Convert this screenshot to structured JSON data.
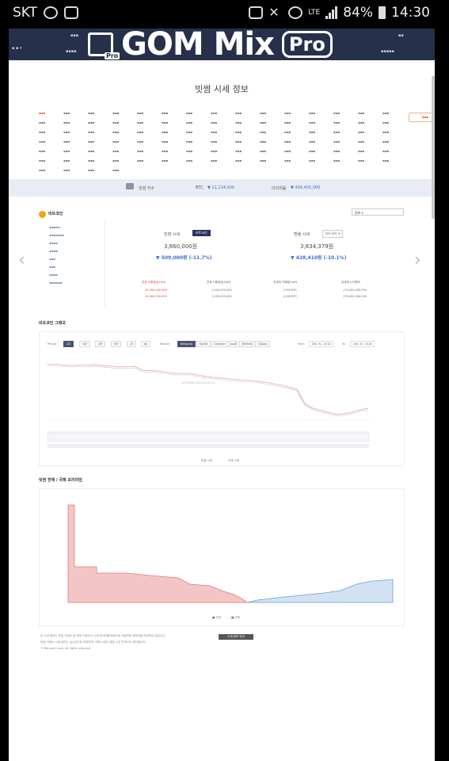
{
  "status_bar": {
    "carrier": "SKT",
    "lte": "LTE",
    "battery": "84%",
    "time": "14:30"
  },
  "watermark": {
    "text": "GOM Mix",
    "badge": "Pro",
    "small_badge": "Pro"
  },
  "page": {
    "title": "빗썸 시세 정보"
  },
  "ticker": {
    "label": "빗썸 지수",
    "btc_label": "BTC",
    "btc_value": "▼ 11,114,000",
    "eth_label": "이더리움",
    "eth_value": "▼ 439,405,000"
  },
  "section": {
    "coin_title": "비트코인",
    "chart_title": "비트코인 그래프",
    "premium_title": "빗썸 전체 / 국제 프리미엄",
    "select_value": "원화"
  },
  "price": {
    "bithumb_label": "빗썸 시세",
    "bithumb_tag": "비트코인",
    "bithumb_price": "3,860,000원",
    "bithumb_change": "▼ 509,000원 (-11.7%)",
    "global_label": "환율 시세",
    "global_select": "비트코인",
    "global_price": "3,834,379원",
    "global_change": "▼ 428,410원 (-10.1%)"
  },
  "stats": {
    "headers": [
      "빗썸 거래대금(24H)",
      "전체 거래대금(24H)",
      "전세계 거래량(24H)",
      "전세계 시가총액"
    ],
    "row1": [
      "10,000,000,000",
      "1,000,000,000",
      "1,000 BTC",
      "170,000,000,000"
    ],
    "row2": [
      "10,000,000,000",
      "1,000,000,000",
      "1,000 BTC",
      "170,000,000,000"
    ]
  },
  "chart1": {
    "period_label": "Period",
    "period_active": "1D",
    "periods": [
      "1W",
      "1M",
      "3M",
      "1Y",
      "All"
    ],
    "market_label": "Market",
    "market_active": "Bithumb",
    "markets": [
      "Korbit",
      "Coinone",
      "Upbit",
      "Bitfinex",
      "Gopax"
    ],
    "from_label": "From",
    "from_value": "Dec 31, 2018",
    "to_label": "To",
    "to_value": "Dec 31, 2018",
    "watermark": "BTC/KRW Bithumb price",
    "legend1": "빗썸 시세",
    "legend2": "국제 시세"
  },
  "chart2": {
    "legend_red": "빗썸",
    "legend_blue": "국제"
  },
  "footer": {
    "line1": "본 시세 정보는 빗썸 거래소 및 국제 거래소의 시세 데이터를 바탕으로 제공되며 정확성을 보장하지 않습니다.",
    "line2": "빗썸 거래소 시세 정보는 실시간으로 반영되며, 국제 시세는 일정 시간 간격으로 갱신됩니다.",
    "line3": "© Bithumb Corp. All rights reserved.",
    "button": "시세 정보 안내"
  },
  "colors": {
    "nav_bg": "#26304a",
    "accent_orange": "#e6672b",
    "change_blue": "#3b6fd0",
    "chart_red": "#e07a7a",
    "chart_blue": "#6d9bd1"
  }
}
